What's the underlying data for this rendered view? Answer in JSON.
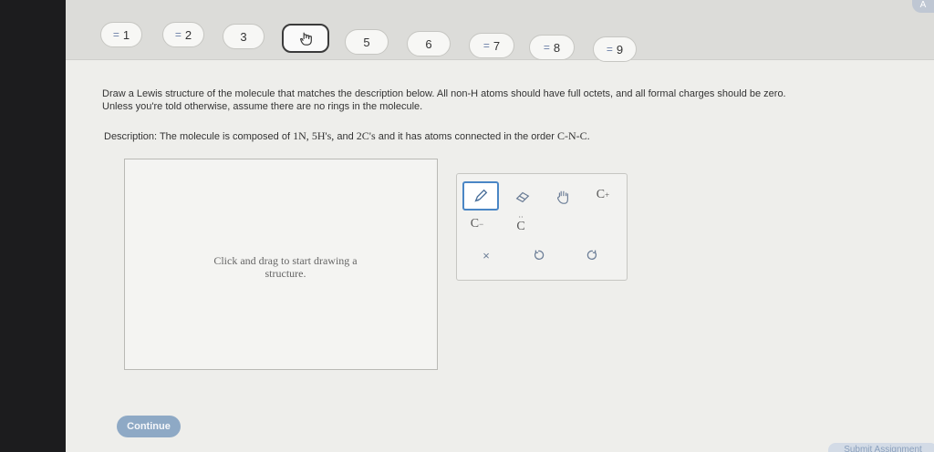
{
  "nav": {
    "q1": "1",
    "q2": "2",
    "q3": "3",
    "q5": "5",
    "q6": "6",
    "q7": "7",
    "q8": "8",
    "q9": "9",
    "answered_mark": "="
  },
  "corner_label": "A",
  "instructions": {
    "line1": "Draw a Lewis structure of the molecule that matches the description below. All non-H atoms should have full octets, and all formal charges should be zero.",
    "line2": "Unless you're told otherwise, assume there are no rings in the molecule."
  },
  "description": {
    "label": "Description:",
    "text_a": "The molecule is composed of",
    "formula_n": "1N,",
    "formula_h": "5H's,",
    "and": "and",
    "formula_c": "2C's",
    "text_b": "and it has atoms connected in the order",
    "order": "C-N-C."
  },
  "canvas": {
    "hint": "Click and drag to start drawing a structure."
  },
  "tools": {
    "carbanion": "C",
    "lone_pair_c": "C",
    "cation": "C",
    "clear": "×"
  },
  "buttons": {
    "continue": "Continue",
    "submit": "Submit Assignment"
  }
}
